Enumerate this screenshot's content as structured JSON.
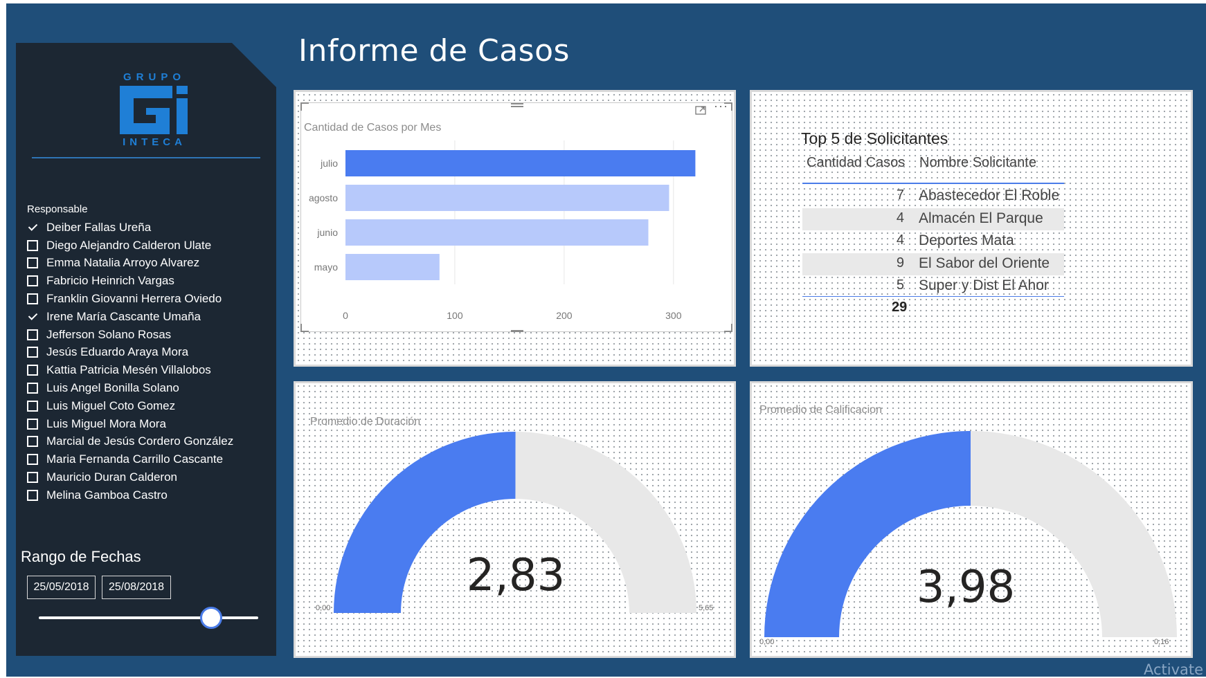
{
  "report": {
    "title": "Informe de Casos"
  },
  "sidebar": {
    "logo": {
      "top_text": "GRUPO",
      "bottom_text": "INTECA"
    },
    "responsable_title": "Responsable",
    "responsables": [
      {
        "name": "Deiber Fallas Ureña",
        "checked": true
      },
      {
        "name": "Diego Alejandro Calderon Ulate",
        "checked": false
      },
      {
        "name": "Emma Natalia Arroyo Alvarez",
        "checked": false
      },
      {
        "name": "Fabricio Heinrich Vargas",
        "checked": false
      },
      {
        "name": "Franklin Giovanni Herrera Oviedo",
        "checked": false
      },
      {
        "name": "Irene María Cascante Umaña",
        "checked": true
      },
      {
        "name": "Jefferson Solano Rosas",
        "checked": false
      },
      {
        "name": "Jesús Eduardo Araya Mora",
        "checked": false
      },
      {
        "name": "Kattia Patricia Mesén Villalobos",
        "checked": false
      },
      {
        "name": "Luis Angel Bonilla Solano",
        "checked": false
      },
      {
        "name": "Luis Miguel Coto Gomez",
        "checked": false
      },
      {
        "name": "Luis Miguel Mora Mora",
        "checked": false
      },
      {
        "name": "Marcial de Jesús Cordero González",
        "checked": false
      },
      {
        "name": "Maria Fernanda Carrillo Cascante",
        "checked": false
      },
      {
        "name": "Mauricio Duran Calderon",
        "checked": false
      },
      {
        "name": "Melina Gamboa Castro",
        "checked": false
      }
    ],
    "date_range": {
      "title": "Rango de Fechas",
      "start": "25/05/2018",
      "end": "25/08/2018"
    }
  },
  "colors": {
    "background": "#1f4e79",
    "sidebar": "#1c2733",
    "accent_bar": "#4a7cf0",
    "light_bar": "#b7c9fb",
    "gauge_fill": "#4a7cf0",
    "gauge_empty": "#e8e8e8"
  },
  "chart_data": [
    {
      "type": "bar",
      "title": "Cantidad de Casos por Mes",
      "categories": [
        "julio",
        "agosto",
        "junio",
        "mayo"
      ],
      "values": [
        320,
        296,
        277,
        86
      ],
      "highlighted": "julio",
      "xlim": [
        0,
        340
      ],
      "xticks": [
        0,
        100,
        200,
        300
      ],
      "grid": true
    },
    {
      "type": "gauge",
      "title": "Promedio de Duración",
      "value": 2.83,
      "value_label": "2,83",
      "min": 0,
      "min_label": "0,00",
      "max": 5.65,
      "max_label": "5,65"
    },
    {
      "type": "gauge",
      "title": "Promedio de Calificacion",
      "value": 3.98,
      "value_label": "3,98",
      "min": 0,
      "min_label": "0,00",
      "max": 0.16,
      "max_label": "0,16"
    }
  ],
  "table": {
    "title": "Top 5 de Solicitantes",
    "headers": [
      "Cantidad Casos",
      "Nombre Solicitante"
    ],
    "rows": [
      {
        "count": "7",
        "name": "Abastecedor El Roble"
      },
      {
        "count": "4",
        "name": "Almacén El Parque"
      },
      {
        "count": "4",
        "name": "Deportes Mata"
      },
      {
        "count": "9",
        "name": "El Sabor del Oriente"
      },
      {
        "count": "5",
        "name": "Super y Dist El Ahor"
      }
    ],
    "total": "29"
  },
  "watermark": "Activate"
}
